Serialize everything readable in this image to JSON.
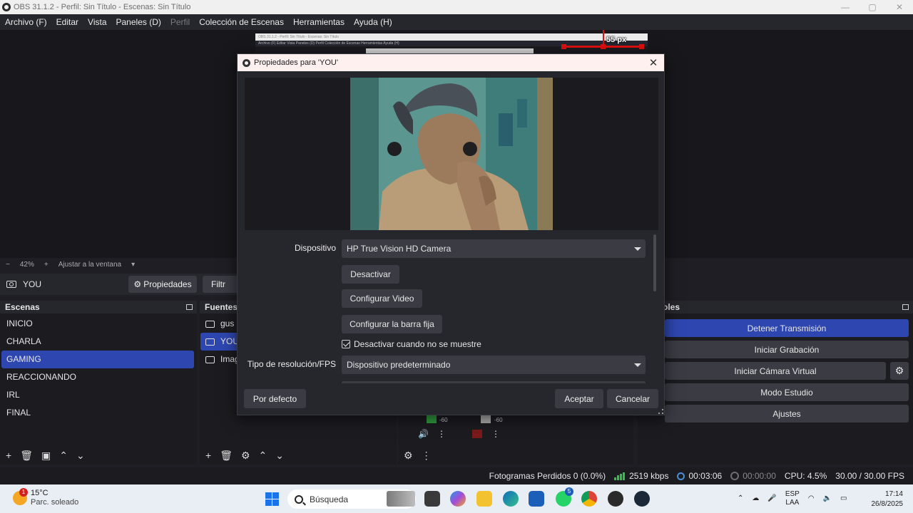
{
  "window": {
    "title": "OBS 31.1.2 - Perfil: Sin Título - Escenas: Sin Título",
    "controls": [
      "—",
      "▢",
      "✕"
    ]
  },
  "menu": {
    "items": [
      "Archivo (F)",
      "Editar",
      "Vista",
      "Paneles (D)",
      "Perfil",
      "Colección de Escenas",
      "Herramientas",
      "Ayuda (H)"
    ]
  },
  "preview": {
    "thumb_title": "OBS 31.1.2 - Perfil: Sin Título - Escenas: Sin Título",
    "thumb_menu": "Archivo (F)   Editar   Vista   Paneles (D)   Perfil   Colección de Escenas   Herramientas   Ayuda (H)",
    "guide_label": "55 px"
  },
  "zoom": {
    "minus": "−",
    "level": "42%",
    "plus": "+",
    "fit_label": "Ajustar a la ventana",
    "caret": "▾"
  },
  "source_toolbar": {
    "selected_source": "YOU",
    "properties_label": "Propiedades",
    "properties_icon": "⚙",
    "filters_label": "Filtr"
  },
  "scenes": {
    "title": "Escenas",
    "items": [
      "INICIO",
      "CHARLA",
      "GAMING",
      "REACCIONANDO",
      "IRL",
      "FINAL"
    ],
    "active_index": 2,
    "footer_icons": [
      "+",
      "🗑",
      "▣",
      "⌃",
      "⌄"
    ]
  },
  "sources": {
    "title": "Fuentes",
    "items": [
      "gus",
      "YOU",
      "Imag"
    ],
    "footer_icons": [
      "+",
      "🗑",
      "⚙",
      "⌃",
      "⌄"
    ]
  },
  "audio": {
    "meter_left_label": "-60",
    "meter_right_label": "-60",
    "footer_icons": [
      "⚙",
      "⋮"
    ],
    "icons": [
      "🔊",
      "⋮",
      "⋮"
    ]
  },
  "controls": {
    "title": "oles",
    "buttons": [
      "Detener Transmisión",
      "Iniciar Grabación",
      "Iniciar Cámara Virtual",
      "Modo Estudio",
      "Ajustes"
    ],
    "gear_icon": "⚙"
  },
  "status": {
    "dropped_frames": "Fotogramas Perdidos 0 (0.0%)",
    "bitrate": "2519 kbps",
    "stream_time": "00:03:06",
    "rec_time": "00:00:00",
    "cpu": "CPU: 4.5%",
    "fps": "30.00 / 30.00 FPS"
  },
  "dialog": {
    "title": "Propiedades para 'YOU'",
    "close_icon": "✕",
    "device_label": "Dispositivo",
    "device_value": "HP True Vision HD Camera",
    "deactivate_label": "Desactivar",
    "config_video_label": "Configurar Video",
    "config_crossbar_label": "Configurar la barra fija",
    "hide_checkbox_label": "Desactivar cuando no se muestre",
    "hide_checkbox_checked": true,
    "resolution_label": "Tipo de resolución/FPS",
    "resolution_value": "Dispositivo predeterminado",
    "default_button": "Por defecto",
    "ok_button": "Aceptar",
    "cancel_button": "Cancelar"
  },
  "taskbar": {
    "weather_temp": "15°C",
    "weather_desc": "Parc. soleado",
    "weather_badge": "1",
    "search_placeholder": "Búsqueda",
    "tray_lang_1": "ESP",
    "tray_lang_2": "LAA",
    "whatsapp_badge": "5",
    "time": "17:14",
    "date": "26/8/2025"
  },
  "colors": {
    "accent": "#2e47b0",
    "panel": "#26262d",
    "background": "#1b1b20",
    "taskbar": "#e9eef4"
  }
}
